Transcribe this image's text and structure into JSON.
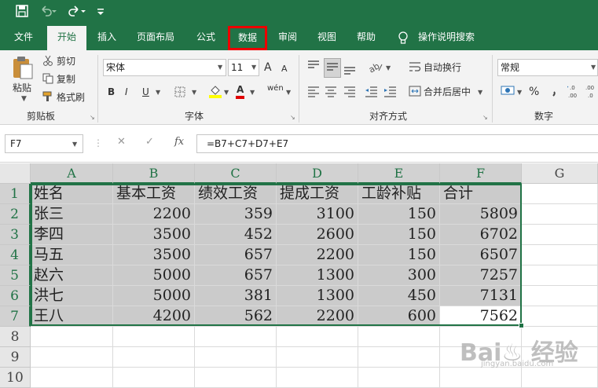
{
  "quick_access": {
    "save_icon": "save-icon",
    "undo_icon": "undo-icon",
    "redo_icon": "redo-icon"
  },
  "tabs": [
    {
      "label": "文件"
    },
    {
      "label": "开始"
    },
    {
      "label": "插入"
    },
    {
      "label": "页面布局"
    },
    {
      "label": "公式"
    },
    {
      "label": "数据"
    },
    {
      "label": "审阅"
    },
    {
      "label": "视图"
    },
    {
      "label": "帮助"
    },
    {
      "label": "操作说明搜索"
    }
  ],
  "ribbon": {
    "clipboard": {
      "paste": "粘贴",
      "cut": "剪切",
      "copy": "复制",
      "format_painter": "格式刷",
      "group": "剪贴板"
    },
    "font": {
      "name": "宋体",
      "size": "11",
      "grow": "A",
      "shrink": "A",
      "bold": "B",
      "italic": "I",
      "underline": "U",
      "color_a": "A",
      "wen": "wén",
      "group": "字体"
    },
    "alignment": {
      "wrap": "自动换行",
      "merge": "合并后居中",
      "group": "对齐方式"
    },
    "number": {
      "format": "常规",
      "percent": "%",
      "group": "数字"
    },
    "colors": {
      "accent": "#217346",
      "highlight": "#e00000",
      "fill_yellow": "#ffff00",
      "font_red": "#e00000"
    }
  },
  "formula_bar": {
    "name_box": "F7",
    "fx": "fx",
    "formula": "=B7+C7+D7+E7"
  },
  "sheet": {
    "columns": [
      "A",
      "B",
      "C",
      "D",
      "E",
      "F",
      "G"
    ],
    "rows": [
      "1",
      "2",
      "3",
      "4",
      "5",
      "6",
      "7",
      "8",
      "9",
      "10"
    ],
    "data": [
      [
        "姓名",
        "基本工资",
        "绩效工资",
        "提成工资",
        "工龄补贴",
        "合计"
      ],
      [
        "张三",
        "2200",
        "359",
        "3100",
        "150",
        "5809"
      ],
      [
        "李四",
        "3500",
        "452",
        "2600",
        "150",
        "6702"
      ],
      [
        "马五",
        "3500",
        "657",
        "2200",
        "150",
        "6507"
      ],
      [
        "赵六",
        "5000",
        "657",
        "1300",
        "300",
        "7257"
      ],
      [
        "洪七",
        "5000",
        "381",
        "1300",
        "450",
        "7131"
      ],
      [
        "王八",
        "4200",
        "562",
        "2200",
        "600",
        "7562"
      ]
    ]
  },
  "watermark": {
    "main": "Bai♨ 经验",
    "sub": "jingyan.baidu.com"
  }
}
